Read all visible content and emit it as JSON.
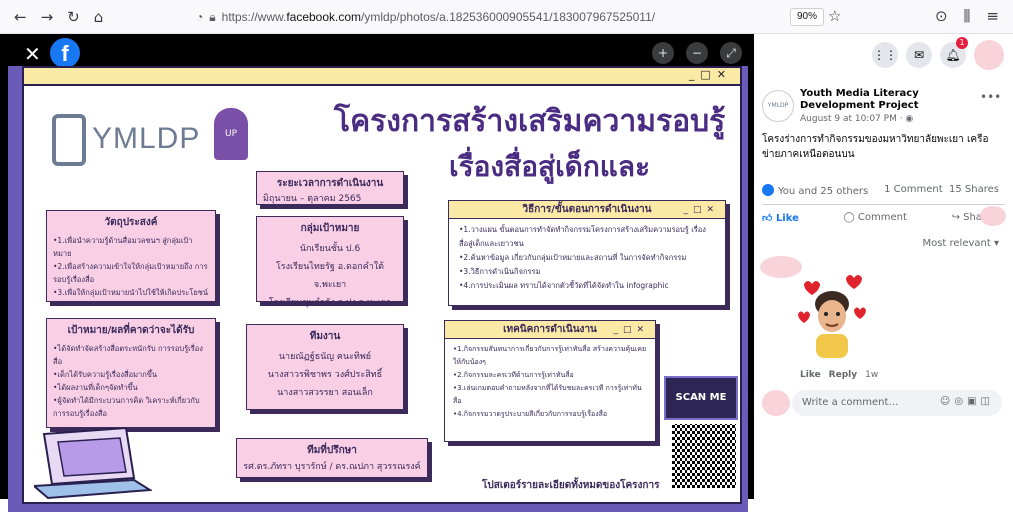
{
  "browser": {
    "url_prefix": "https://www.",
    "url_host": "facebook.com",
    "url_path": "/ymldp/photos/a.182536000905541/183007967525011/",
    "zoom": "90%"
  },
  "poster": {
    "logo_text": "YMLDP",
    "title_line1": "โครงการสร้างเสริมความรอบรู้",
    "title_line2": "เรื่องสื่อสู่เด็กและเยาวชน",
    "period": {
      "title": "ระยะเวลาการดำเนินงาน",
      "body": "มิถุนายน – ตุลาคม 2565"
    },
    "objective": {
      "title": "วัตถุประสงค์",
      "items": [
        "•1.เพื่อนำความรู้ด้านสื่อมวลชนฯ สู่กลุ่มเป้าหมาย",
        "•2.เพื่อสร้างความเข้าใจให้กลุ่มเป้าหมายถึง การรอบรู้เรื่องสื่อ",
        "•3.เพื่อให้กลุ่มเป้าหมายนำไปใช้ให้เกิดประโยชน์"
      ]
    },
    "target": {
      "title": "กลุ่มเป้าหมาย",
      "items": [
        "นักเรียนชั้น ป.6",
        "โรงเรียนไทยรัฐ อ.ดอกคำใต้ จ.พะเยา",
        "โรงเรียนชุมกำลัง อ.ปง จ.พะเยา"
      ]
    },
    "method": {
      "title": "วิธีการ/ขั้นตอนการดำเนินงาน",
      "items": [
        "•1.วางแผน ขั้นตอนการทำจัดทำกิจกรรมโครงการสร้างเสริมความรอบรู้ เรื่องสื่อสู่เด็กและเยาวชน",
        "•2.ค้นหาข้อมูล เกี่ยวกับกลุ่มเป้าหมายและสถานที่ ในการจัดทำกิจกรรม",
        "•3.วิธีการดำเนินกิจกรรม",
        "•4.การประเมินผล ทราบได้จากตัวชี้วัดที่ได้จัดทำใน infographic"
      ]
    },
    "goal": {
      "title": "เป้าหมาย/ผลที่คาดว่าจะได้รับ",
      "items": [
        "•ได้จัดทำจัดสร้างสื่อตระหนักรับ การรอบรู้เรื่องสื่อ",
        "•เด็กได้รับความรู้เรื่องสื่อมากขึ้น",
        "•ได้ผลงานที่เด็กๆจัดทำขึ้น",
        "•ผู้จัดทำได้มีกระบวนการคิด วิเคราะห์เกี่ยวกับ การรอบรู้เรื่องสื่อ"
      ]
    },
    "team": {
      "title": "ทีมงาน",
      "items": [
        "นายณัฏฐ์ธนัญ ฅนะทิพย์",
        "นางสาวรพิชาพร วงศ์ประสิทธิ์",
        "นางสาวสวรรยา สอนเล็ก"
      ]
    },
    "technique": {
      "title": "เทคนิคการดำเนินงาน",
      "items": [
        "•1.กิจกรรมสันทนาการเกี่ยวกับการรู้เท่าทันสื่อ สร้างความคุ้นเคยให้กับน้องๆ",
        "•2.กิจกรรมละครเวทีด้านการรู้เท่าทันสื่อ",
        "•3.เล่นเกมตอบคำถามหลังจากที่ได้รับชมละครเวที การรู้เท่าทันสื่อ",
        "•4.กิจกรรมวาดรูประบายสีเกี่ยวกับการรอบรู้เรื่องสื่อ"
      ]
    },
    "advisor": {
      "title": "ทีมที่ปรึกษา",
      "body": "รศ.ดร.ภัทรา บุรารักษ์ / ดร.ณปภา สุวรรณรงค์"
    },
    "scan": "SCAN ME",
    "footer": "โปสเตอร์รายละเอียดทั้งหมดของโครงการ"
  },
  "panel": {
    "notification_count": "1",
    "page_name": "Youth Media Literacy Development Project",
    "date": "August 9 at 10:07 PM · ",
    "post_text": "โครงร่างการทำกิจกรรมของมหาวิทยาลัยพะเยา เครือข่ายภาคเหนือตอนบน",
    "reactions": "You and 25 others",
    "comments": "1 Comment",
    "shares": "15 Shares",
    "like": "Like",
    "comment": "Comment",
    "share": "Share",
    "sort": "Most relevant ▾",
    "c_like": "Like",
    "c_reply": "Reply",
    "c_time": "1w",
    "placeholder": "Write a comment…"
  }
}
